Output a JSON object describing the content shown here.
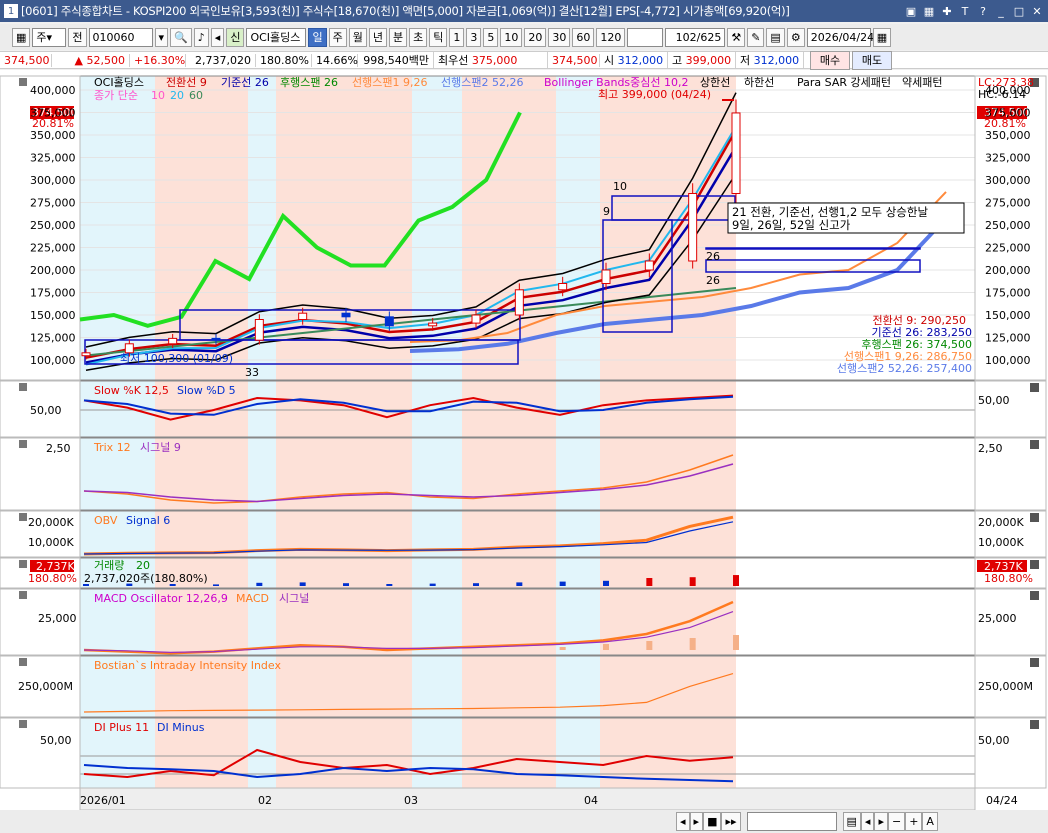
{
  "titlebar": {
    "window_num": "1",
    "text": "[0601] 주식종합차트 - KOSPI200 외국인보유[3,593(천)] 주식수[18,670(천)] 액면[5,000] 자본금[1,069(억)] 결산[12월] EPS[-4,772] 시가총액[69,920(억)]",
    "tool_icons": [
      "restore-icon",
      "layout-icon",
      "pin-icon",
      "text-icon",
      "help-icon",
      "minimize-icon",
      "maximize-icon",
      "close-icon"
    ]
  },
  "toolbar": {
    "mode": "주",
    "period": "전",
    "code": "010060",
    "new_badge": "신",
    "stock_name": "OCI홀딩스",
    "tabs": [
      "일",
      "주",
      "월",
      "년",
      "분",
      "초",
      "틱"
    ],
    "active_tab": "일",
    "intervals": [
      "1",
      "3",
      "5",
      "10",
      "20",
      "30",
      "60",
      "120"
    ],
    "page": "102/625",
    "date": "2026/04/24"
  },
  "quote": {
    "price": "374,500",
    "change": "▲ 52,500",
    "change_pct": "+16.30%",
    "volume": "2,737,020",
    "vol_ratio": "180.80%",
    "turnover": "14.66%",
    "amount": "998,540백만",
    "best_ask_label": "최우선",
    "best_ask": "375,000",
    "best_bid": "374,500",
    "open_label": "시",
    "open": "312,000",
    "high_label": "고",
    "high": "399,000",
    "low_label": "저",
    "low": "312,000",
    "buy": "매수",
    "sell": "매도"
  },
  "legend": {
    "name": "OCI홀딩스",
    "conversion": "전환선 9",
    "base": "기준선 26",
    "lagging": "후행스팬 26",
    "lead1": "선행스팬1 9,26",
    "lead2": "선행스팬2 52,26",
    "bb": "Bollinger Bands중심선 10,2",
    "upper": "상한선",
    "lower": "하한선",
    "sar": "Para SAR 강세패턴",
    "sar2": "약세패턴",
    "ma_label": "종가 단순",
    "ma1": "10",
    "ma2": "20",
    "ma3": "60",
    "lc": "LC:273.38",
    "hc": "HC:-6.14"
  },
  "colors": {
    "up": "#e00000",
    "down": "#0030d0",
    "sar_green": "#22e022",
    "conversion": "#cc0000",
    "base": "#0000aa",
    "lagging": "#008800",
    "lead1": "#ff8a3c",
    "lead2": "#5a7ae8",
    "bb": "#000000",
    "ma10": "#ff55cc",
    "ma20": "#22b8ee",
    "ma60": "#3a8a5a",
    "band_pink": "#fde1d8",
    "band_cyan": "#e2f5fb"
  },
  "price_axis": {
    "labels": [
      "400,000",
      "375,000",
      "350,000",
      "325,000",
      "300,000",
      "275,000",
      "250,000",
      "225,000",
      "200,000",
      "175,000",
      "150,000",
      "125,000",
      "100,000"
    ],
    "current": "374,500",
    "current_pct": "20.81%"
  },
  "annotations": {
    "high_note": "최고 399,000 (04/24)",
    "low_note": "최저 100,300 (01/09)",
    "new_high_note_1": "21 전환, 기준선, 선행1,2 모두 상승한날",
    "new_high_note_2": "9일, 26일, 52일 신고가",
    "counts": [
      "10",
      "9",
      "26",
      "26",
      "33",
      "9",
      "26",
      "26"
    ]
  },
  "right_values": {
    "conversion": "전환선 9: 290,250",
    "base": "기준선 26: 283,250",
    "lagging": "후행스팬 26: 374,500",
    "lead1": "선행스팬1 9,26: 286,750",
    "lead2": "선행스팬2 52,26: 257,400"
  },
  "panels": {
    "stoch": {
      "title_k": "Slow %K 12,5",
      "title_d": "Slow %D 5",
      "axis": "50,00"
    },
    "trix": {
      "title": "Trix 12",
      "signal": "시그널 9",
      "axis": "2,50"
    },
    "obv": {
      "title": "OBV",
      "signal": "Signal 6",
      "axis1": "20,000K",
      "axis2": "10,000K"
    },
    "volume": {
      "title": "거래량",
      "ma": "20",
      "value": "2,737,020주(180.80%)",
      "side_val": "2,737K",
      "side_pct": "180.80%"
    },
    "macd": {
      "title": "MACD Oscillator 12,26,9",
      "macd": "MACD",
      "signal": "시그널",
      "axis": "25,000"
    },
    "bostian": {
      "title": "Bostian`s Intraday Intensity Index",
      "axis": "250,000M"
    },
    "dmi": {
      "title_plus": "DI Plus 11",
      "title_minus": "DI Minus",
      "axis": "50,00"
    }
  },
  "x_axis": {
    "labels": [
      "2026/01",
      "02",
      "03",
      "04"
    ],
    "right": "04/24"
  },
  "chart_data": [
    {
      "type": "candlestick",
      "title": "OCI홀딩스",
      "ylim": [
        95000,
        405000
      ],
      "x": [
        "01/09",
        "01/16",
        "01/23",
        "01/30",
        "02/06",
        "02/13",
        "02/20",
        "02/27",
        "03/06",
        "03/13",
        "03/20",
        "03/27",
        "04/03",
        "04/10",
        "04/17",
        "04/24"
      ],
      "close": [
        108000,
        118000,
        124000,
        122000,
        145000,
        152000,
        148000,
        138000,
        141000,
        150000,
        178000,
        185000,
        200000,
        210000,
        285000,
        374500
      ],
      "sar": [
        145000,
        150000,
        138000,
        148000,
        210000,
        190000,
        260000,
        225000,
        205000,
        205000,
        255000,
        270000,
        300000,
        375000
      ]
    },
    {
      "type": "line",
      "title": "Slow %K 12,5",
      "ylim": [
        0,
        100
      ],
      "values": [
        70,
        55,
        30,
        50,
        75,
        70,
        60,
        35,
        60,
        75,
        55,
        40,
        60,
        70,
        75,
        80
      ]
    },
    {
      "type": "bar",
      "title": "거래량",
      "values": [
        0.5,
        0.6,
        0.5,
        0.4,
        0.8,
        0.9,
        0.7,
        0.5,
        0.6,
        0.7,
        0.9,
        1.1,
        1.3,
        2.0,
        2.2,
        2.737
      ]
    }
  ]
}
